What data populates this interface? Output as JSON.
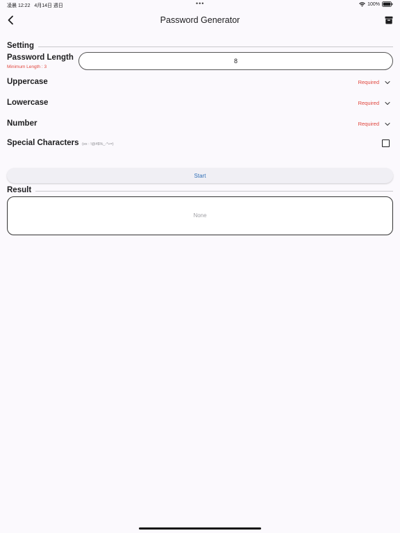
{
  "status_bar": {
    "time": "凌晨 12:22",
    "date": "4月14日 週日",
    "dots": "•••",
    "battery_percent": "100%"
  },
  "nav": {
    "title": "Password Generator",
    "back_icon": "chevron-left-icon",
    "action_icon": "archive-icon"
  },
  "setting": {
    "section_title": "Setting",
    "password_length": {
      "label": "Password Length",
      "note": "Minimum Length : 3",
      "value": "8"
    },
    "uppercase": {
      "label": "Uppercase",
      "value": "Required"
    },
    "lowercase": {
      "label": "Lowercase",
      "value": "Required"
    },
    "number": {
      "label": "Number",
      "value": "Required"
    },
    "special": {
      "label": "Special Characters",
      "example": "(ex : !@#$%_-*+=)",
      "checked": false
    }
  },
  "start_button": {
    "label": "Start"
  },
  "result": {
    "section_title": "Result",
    "value": "None"
  },
  "colors": {
    "accent_red": "#e0463d",
    "accent_blue": "#2f6fb7",
    "background": "#fbf9fd"
  }
}
